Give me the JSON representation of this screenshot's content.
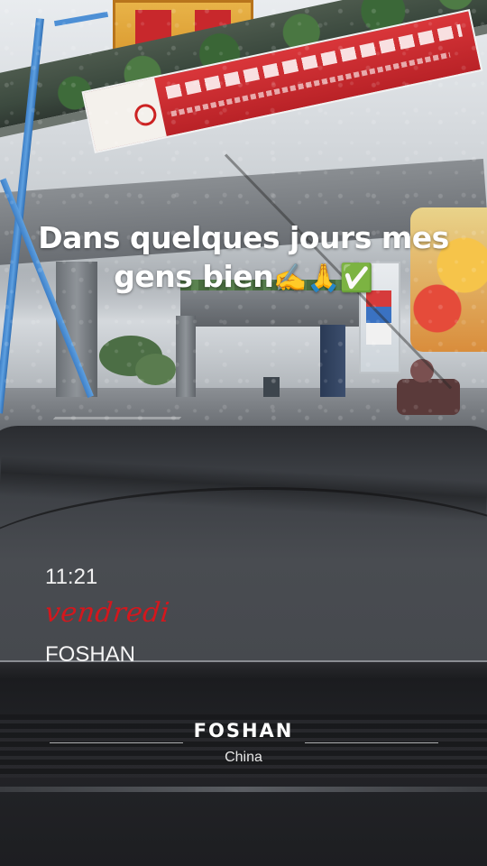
{
  "story": {
    "caption_line1": "Dans quelques jours mes",
    "caption_line2": "gens bien",
    "caption_emojis": "✍️🙏✅"
  },
  "time_sticker": {
    "time": "11:21",
    "day": "vendredi",
    "city": "FOSHAN"
  },
  "location_sticker": {
    "city": "FOSHAN",
    "country": "China"
  },
  "colors": {
    "day_text": "#d4171d",
    "caption_text": "#ffffff"
  }
}
